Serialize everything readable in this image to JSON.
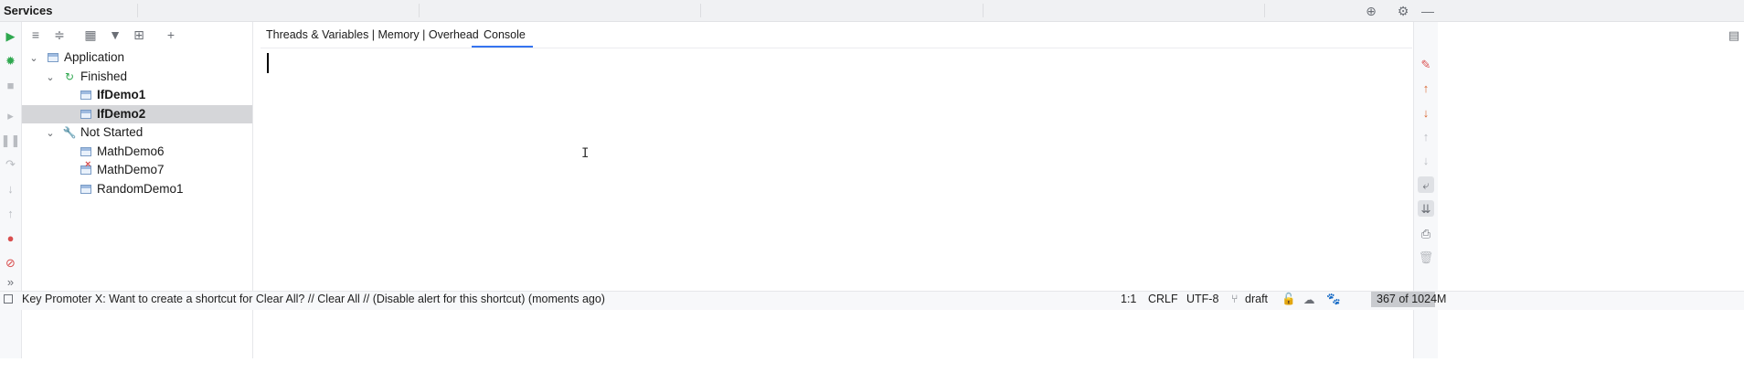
{
  "window": {
    "title": "Services"
  },
  "colors": {
    "accent": "#3574f0",
    "run_green": "#2fa84f",
    "stop_red": "#d94f4f",
    "selection": "#d5d6d9"
  },
  "title_icons": [
    "crosshair-icon",
    "gear-icon",
    "minimize-icon"
  ],
  "left_strip_icons": [
    "run-icon",
    "debug-icon",
    "stop-icon",
    "resume-icon",
    "pause-icon",
    "step-over-icon",
    "step-into-icon",
    "step-out-icon",
    "breakpoints-icon",
    "mute-breakpoints-icon",
    "more-icon"
  ],
  "tree_toolbar_icons": [
    "expand-all-icon",
    "collapse-all-icon",
    "group-by-icon",
    "filter-icon",
    "new-service-icon",
    "add-icon"
  ],
  "tree": [
    {
      "label": "Application",
      "level": 0,
      "expanded": true,
      "icon": "application-icon",
      "bold": false,
      "selected": false
    },
    {
      "label": "Finished",
      "level": 1,
      "expanded": true,
      "icon": "finished-icon",
      "bold": false,
      "selected": false
    },
    {
      "label": "IfDemo1",
      "level": 2,
      "icon": "class-window-icon",
      "bold": true,
      "selected": false
    },
    {
      "label": "IfDemo2",
      "level": 2,
      "icon": "class-window-icon",
      "bold": true,
      "selected": true
    },
    {
      "label": "Not Started",
      "level": 1,
      "expanded": true,
      "icon": "wrench-icon",
      "bold": false,
      "selected": false
    },
    {
      "label": "MathDemo6",
      "level": 2,
      "icon": "class-window-icon",
      "bold": false,
      "selected": false
    },
    {
      "label": "MathDemo7",
      "level": 2,
      "icon": "class-error-icon",
      "bold": false,
      "selected": false
    },
    {
      "label": "RandomDemo1",
      "level": 2,
      "icon": "class-window-icon",
      "bold": false,
      "selected": false
    }
  ],
  "tabs": [
    {
      "label": "Threads & Variables | Memory | Overhead",
      "active": false
    },
    {
      "label": "Console",
      "active": true
    }
  ],
  "right_strip_icons": [
    "layout-icon",
    "clear-icon",
    "up-arrow-icon",
    "down-arrow-icon",
    "up-disabled-icon",
    "down-disabled-icon",
    "soft-wrap-icon",
    "scroll-to-end-icon",
    "print-icon",
    "trash-icon"
  ],
  "status": {
    "message": "Key Promoter X: Want to create a shortcut for Clear All? // Clear All // (Disable alert for this shortcut) (moments ago)",
    "position": "1:1",
    "line_separator": "CRLF",
    "encoding": "UTF-8",
    "branch": "draft",
    "memory": "367 of 1024M"
  }
}
